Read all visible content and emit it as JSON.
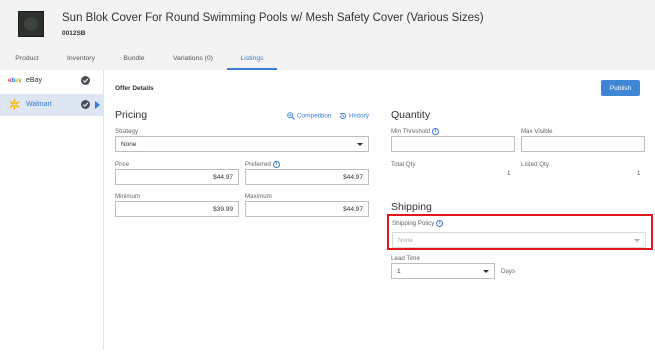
{
  "product": {
    "title": "Sun Blok Cover For Round Swimming Pools w/ Mesh Safety Cover (Various Sizes)",
    "sku": "0012SB"
  },
  "tabs": [
    {
      "label": "Product"
    },
    {
      "label": "Inventory"
    },
    {
      "label": "Bundle"
    },
    {
      "label": "Variations (0)"
    },
    {
      "label": "Listings"
    }
  ],
  "sidebar": {
    "items": [
      {
        "label": "eBay",
        "icon": "ebay-logo",
        "checked": true
      },
      {
        "label": "Walmart",
        "icon": "walmart-spark-logo",
        "checked": true
      }
    ]
  },
  "offer": {
    "title": "Offer Details",
    "publish_label": "Publish"
  },
  "pricing": {
    "heading": "Pricing",
    "competition_link": "Competition",
    "history_link": "History",
    "strategy_label": "Strategy",
    "strategy_value": "None",
    "price_label": "Price",
    "price_value": "$44.97",
    "preferred_label": "Preferred",
    "preferred_value": "$44.97",
    "minimum_label": "Minimum",
    "minimum_value": "$39.99",
    "maximum_label": "Maximum",
    "maximum_value": "$44.97"
  },
  "quantity": {
    "heading": "Quantity",
    "min_threshold_label": "Min Threshold",
    "max_visible_label": "Max Visible",
    "total_qty_label": "Total Qty",
    "total_qty_value": "1",
    "listed_qty_label": "Listed Qty",
    "listed_qty_value": "1"
  },
  "shipping": {
    "heading": "Shipping",
    "policy_label": "Shipping Policy",
    "policy_placeholder": "None",
    "lead_time_label": "Lead Time",
    "lead_time_value": "1",
    "lead_time_unit": "Days",
    "highlight_color": "#e4161d"
  },
  "colors": {
    "accent": "#3a7bd5",
    "publish_bg": "#3f86d6",
    "header_bg": "#f3f3f3"
  }
}
